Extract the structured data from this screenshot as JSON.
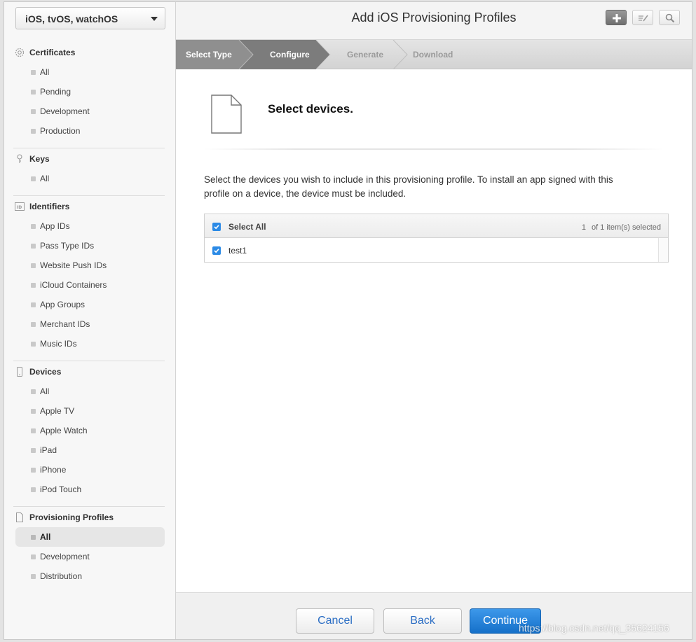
{
  "platform_select": {
    "value": "iOS, tvOS, watchOS"
  },
  "sidebar": {
    "certificates": {
      "title": "Certificates",
      "items": [
        "All",
        "Pending",
        "Development",
        "Production"
      ]
    },
    "keys": {
      "title": "Keys",
      "items": [
        "All"
      ]
    },
    "identifiers": {
      "title": "Identifiers",
      "items": [
        "App IDs",
        "Pass Type IDs",
        "Website Push IDs",
        "iCloud Containers",
        "App Groups",
        "Merchant IDs",
        "Music IDs"
      ]
    },
    "devices": {
      "title": "Devices",
      "items": [
        "All",
        "Apple TV",
        "Apple Watch",
        "iPad",
        "iPhone",
        "iPod Touch"
      ]
    },
    "provisioning": {
      "title": "Provisioning Profiles",
      "items": [
        "All",
        "Development",
        "Distribution"
      ],
      "active": "All"
    }
  },
  "header": {
    "title": "Add iOS Provisioning Profiles",
    "toolbar_icons": [
      "plus-icon",
      "edit-icon",
      "search-icon"
    ]
  },
  "steps": {
    "items": [
      "Select Type",
      "Configure",
      "Generate",
      "Download"
    ],
    "current": "Configure"
  },
  "content": {
    "title": "Select devices.",
    "instructions": "Select the devices you wish to include in this provisioning profile. To install an app signed with this profile on a device, the device must be included."
  },
  "device_table": {
    "select_all_label": "Select All",
    "selected_count": "1",
    "selection_text": "of 1 item(s) selected",
    "rows": [
      {
        "name": "test1",
        "checked": true
      }
    ]
  },
  "footer": {
    "cancel_label": "Cancel",
    "back_label": "Back",
    "continue_label": "Continue"
  },
  "watermark": "https://blog.csdn.net/qq_35624156",
  "colors": {
    "accent": "#2b8ae6",
    "primary_button": "#1570c9",
    "step_active": "#8a8a8a"
  }
}
